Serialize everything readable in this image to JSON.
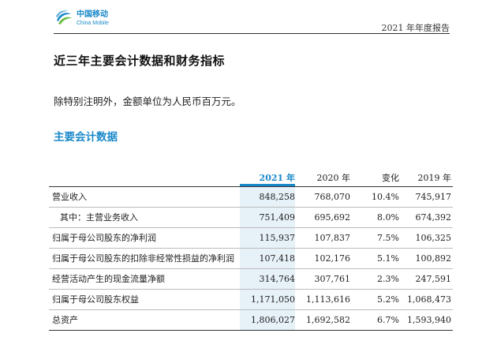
{
  "header": {
    "logo_cn": "中国移动",
    "logo_en": "China Mobile",
    "report_title": "2021 年年度报告"
  },
  "page_title": "近三年主要会计数据和财务指标",
  "note": "除特别注明外，金额单位为人民币百万元。",
  "section_title": "主要会计数据",
  "table": {
    "columns": [
      "2021 年",
      "2020 年",
      "变化",
      "2019 年"
    ],
    "rows": [
      {
        "label": "营业收入",
        "v2021": "848,258",
        "v2020": "768,070",
        "change": "10.4%",
        "v2019": "745,917"
      },
      {
        "label": "其中：主营业务收入",
        "v2021": "751,409",
        "v2020": "695,692",
        "change": "8.0%",
        "v2019": "674,392"
      },
      {
        "label": "归属于母公司股东的净利润",
        "v2021": "115,937",
        "v2020": "107,837",
        "change": "7.5%",
        "v2019": "106,325"
      },
      {
        "label": "归属于母公司股东的扣除非经常性损益的净利润",
        "v2021": "107,418",
        "v2020": "102,176",
        "change": "5.1%",
        "v2019": "100,892"
      },
      {
        "label": "经营活动产生的现金流量净额",
        "v2021": "314,764",
        "v2020": "307,761",
        "change": "2.3%",
        "v2019": "247,591"
      },
      {
        "label": "归属于母公司股东权益",
        "v2021": "1,171,050",
        "v2020": "1,113,616",
        "change": "5.2%",
        "v2019": "1,068,473"
      },
      {
        "label": "总资产",
        "v2021": "1,806,027",
        "v2020": "1,692,582",
        "change": "6.7%",
        "v2019": "1,593,940"
      }
    ]
  },
  "colors": {
    "brand_blue": "#1a89c9",
    "highlight_column": "#e6f1f8"
  },
  "icons": {
    "logo": "china-mobile-logo-icon"
  }
}
